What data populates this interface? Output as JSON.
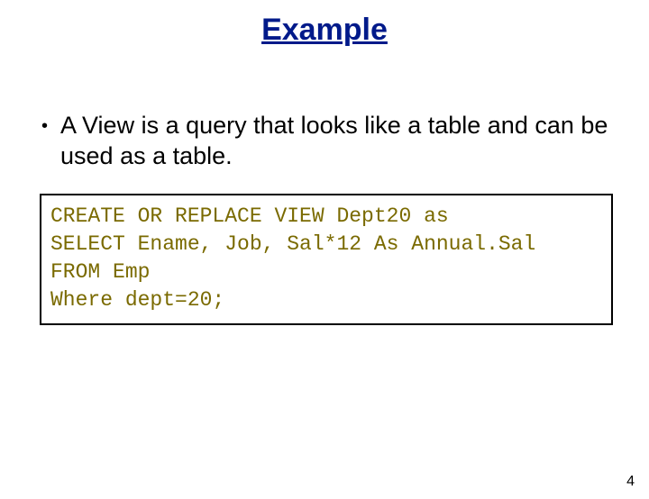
{
  "title": "Example",
  "bullet": "A View is a query that looks like a table and can be used as a table.",
  "code": {
    "line1": "CREATE OR REPLACE VIEW Dept20 as",
    "line2": "SELECT Ename, Job, Sal*12 As Annual.Sal",
    "line3": "FROM Emp",
    "line4": "Where dept=20;"
  },
  "pageNumber": "4"
}
